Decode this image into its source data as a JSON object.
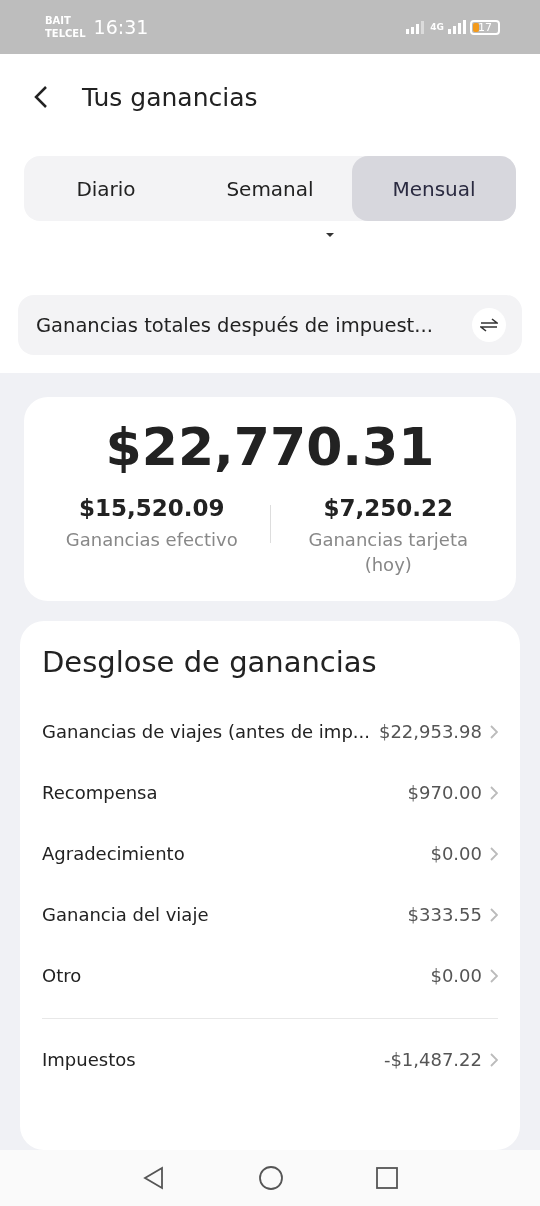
{
  "status_bar": {
    "carrier_top": "BAIT",
    "carrier_bottom": "TELCEL",
    "time": "16:31",
    "network": "4G",
    "battery": "17"
  },
  "header": {
    "title": "Tus ganancias"
  },
  "tabs": [
    {
      "label": "Diario",
      "selected": false
    },
    {
      "label": "Semanal",
      "selected": false
    },
    {
      "label": "Mensual",
      "selected": true
    }
  ],
  "summary_selector": {
    "label": "Ganancias totales después de impuest..."
  },
  "total": {
    "amount": "$22,770.31",
    "split": [
      {
        "amount": "$15,520.09",
        "label": "Ganancias efectivo"
      },
      {
        "amount": "$7,250.22",
        "label": "Ganancias tarjeta (hoy)"
      }
    ]
  },
  "breakdown": {
    "title": "Desglose de ganancias",
    "rows": [
      {
        "label": "Ganancias de viajes (antes de imp...",
        "value": "$22,953.98",
        "divider_before": false
      },
      {
        "label": "Recompensa",
        "value": "$970.00",
        "divider_before": false
      },
      {
        "label": "Agradecimiento",
        "value": "$0.00",
        "divider_before": false
      },
      {
        "label": "Ganancia del viaje",
        "value": "$333.55",
        "divider_before": false
      },
      {
        "label": "Otro",
        "value": "$0.00",
        "divider_before": false
      },
      {
        "label": "Impuestos",
        "value": "-$1,487.22",
        "divider_before": true
      }
    ]
  }
}
